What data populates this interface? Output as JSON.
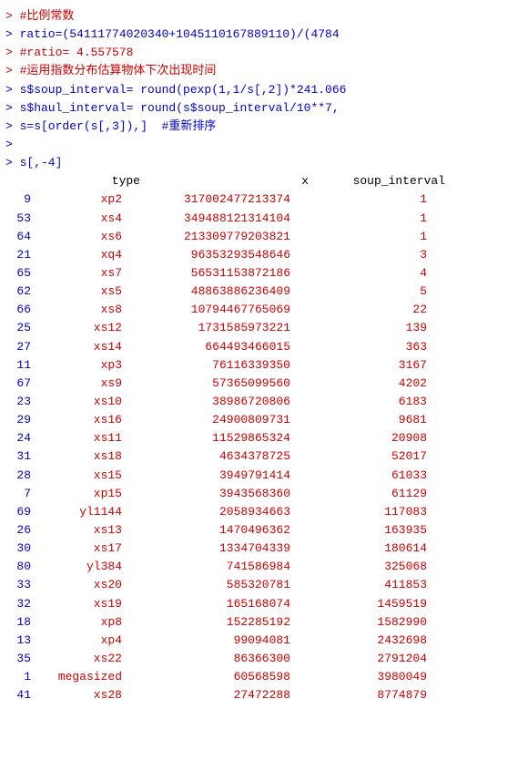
{
  "console": {
    "lines": [
      {
        "type": "comment",
        "text": "> #比例常数"
      },
      {
        "type": "code",
        "text": "> ratio=(54111774020340+1045110167889110)/(4784"
      },
      {
        "type": "comment",
        "text": "> #ratio= 4.557578"
      },
      {
        "type": "comment",
        "text": "> #运用指数分布估算物体下次出现时间"
      },
      {
        "type": "code",
        "text": "> s$soup_interval= round(pexp(1,1/s[,2])*241.066"
      },
      {
        "type": "code",
        "text": "> s$haul_interval= round(s$soup_interval/10**7,"
      },
      {
        "type": "code",
        "text": "> s=s[order(s[,3]),]  #重新排序"
      },
      {
        "type": "blank",
        "text": ">"
      },
      {
        "type": "code",
        "text": "> s[,-4]"
      }
    ],
    "table": {
      "headers": [
        "",
        "type",
        "x",
        "soup_interval"
      ],
      "rows": [
        {
          "rownum": "9",
          "type": "xp2",
          "x": "317002477213374",
          "soup": "1"
        },
        {
          "rownum": "53",
          "type": "xs4",
          "x": "349488121314104",
          "soup": "1"
        },
        {
          "rownum": "64",
          "type": "xs6",
          "x": "213309779203821",
          "soup": "1"
        },
        {
          "rownum": "21",
          "type": "xq4",
          "x": "96353293548646",
          "soup": "3"
        },
        {
          "rownum": "65",
          "type": "xs7",
          "x": "56531153872186",
          "soup": "4"
        },
        {
          "rownum": "62",
          "type": "xs5",
          "x": "48863886236409",
          "soup": "5"
        },
        {
          "rownum": "66",
          "type": "xs8",
          "x": "10794467765069",
          "soup": "22"
        },
        {
          "rownum": "25",
          "type": "xs12",
          "x": "1731585973221",
          "soup": "139"
        },
        {
          "rownum": "27",
          "type": "xs14",
          "x": "664493466015",
          "soup": "363"
        },
        {
          "rownum": "11",
          "type": "xp3",
          "x": "76116339350",
          "soup": "3167"
        },
        {
          "rownum": "67",
          "type": "xs9",
          "x": "57365099560",
          "soup": "4202"
        },
        {
          "rownum": "23",
          "type": "xs10",
          "x": "38986720806",
          "soup": "6183"
        },
        {
          "rownum": "29",
          "type": "xs16",
          "x": "24900809731",
          "soup": "9681"
        },
        {
          "rownum": "24",
          "type": "xs11",
          "x": "11529865324",
          "soup": "20908"
        },
        {
          "rownum": "31",
          "type": "xs18",
          "x": "4634378725",
          "soup": "52017"
        },
        {
          "rownum": "28",
          "type": "xs15",
          "x": "3949791414",
          "soup": "61033"
        },
        {
          "rownum": "7",
          "type": "xp15",
          "x": "3943568360",
          "soup": "61129"
        },
        {
          "rownum": "69",
          "type": "yl1144",
          "x": "2058934663",
          "soup": "117083"
        },
        {
          "rownum": "26",
          "type": "xs13",
          "x": "1470496362",
          "soup": "163935"
        },
        {
          "rownum": "30",
          "type": "xs17",
          "x": "1334704339",
          "soup": "180614"
        },
        {
          "rownum": "80",
          "type": "yl384",
          "x": "741586984",
          "soup": "325068"
        },
        {
          "rownum": "33",
          "type": "xs20",
          "x": "585320781",
          "soup": "411853"
        },
        {
          "rownum": "32",
          "type": "xs19",
          "x": "165168074",
          "soup": "1459519"
        },
        {
          "rownum": "18",
          "type": "xp8",
          "x": "152285192",
          "soup": "1582990"
        },
        {
          "rownum": "13",
          "type": "xp4",
          "x": "99094081",
          "soup": "2432698"
        },
        {
          "rownum": "35",
          "type": "xs22",
          "x": "86366300",
          "soup": "2791204"
        },
        {
          "rownum": "1",
          "type": "megasized",
          "x": "60568598",
          "soup": "3980049"
        },
        {
          "rownum": "41",
          "type": "xs28",
          "x": "27472288",
          "soup": "8774879"
        }
      ]
    }
  }
}
